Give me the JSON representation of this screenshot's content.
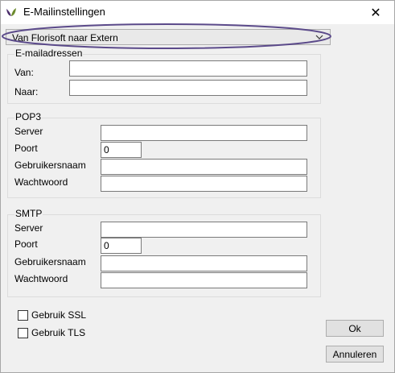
{
  "window": {
    "title": "E-Mailinstellingen",
    "close_glyph": "✕"
  },
  "direction_select": {
    "value": "Van Florisoft naar Extern"
  },
  "emailadressen": {
    "title": "E-mailadressen",
    "van_label": "Van:",
    "van_value": "",
    "naar_label": "Naar:",
    "naar_value": ""
  },
  "pop3": {
    "title": "POP3",
    "server_label": "Server",
    "server_value": "",
    "port_label": "Poort",
    "port_value": "0",
    "user_label": "Gebruikersnaam",
    "user_value": "",
    "password_label": "Wachtwoord",
    "password_value": ""
  },
  "smtp": {
    "title": "SMTP",
    "server_label": "Server",
    "server_value": "",
    "port_label": "Poort",
    "port_value": "0",
    "user_label": "Gebruikersnaam",
    "user_value": "",
    "password_label": "Wachtwoord",
    "password_value": ""
  },
  "options": {
    "ssl_label": "Gebruik SSL",
    "tls_label": "Gebruik TLS",
    "ssl_checked": false,
    "tls_checked": false
  },
  "buttons": {
    "ok": "Ok",
    "cancel": "Annuleren"
  },
  "colors": {
    "annotation_ellipse": "#5b4a8a",
    "app_icon_green": "#6c8a2e",
    "app_icon_purple": "#4a2d6b"
  },
  "icons": {
    "app": "florisoft-leaf-icon",
    "close": "close-icon",
    "dropdown": "chevron-down-icon"
  }
}
